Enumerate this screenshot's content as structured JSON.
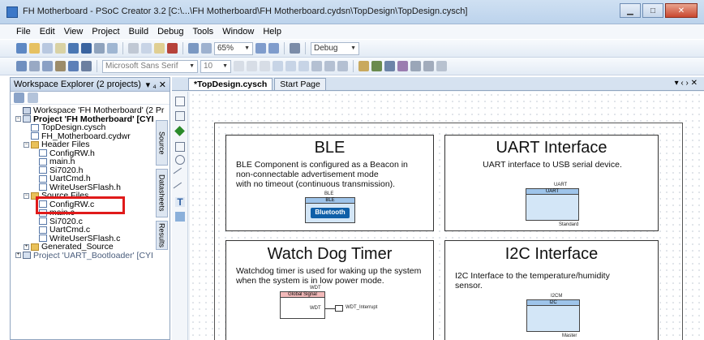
{
  "window": {
    "title": "FH Motherboard - PSoC Creator 3.2  [C:\\...\\FH Motherboard\\FH Motherboard.cydsn\\TopDesign\\TopDesign.cysch]"
  },
  "menu": [
    "File",
    "Edit",
    "View",
    "Project",
    "Build",
    "Debug",
    "Tools",
    "Window",
    "Help"
  ],
  "toolbar": {
    "zoom": "65%",
    "config": "Debug",
    "font_name": "Microsoft Sans Serif",
    "font_size": "10"
  },
  "workspace": {
    "title": "Workspace Explorer (2 projects)",
    "pin": "▾ ₄ ✕",
    "tree": [
      {
        "label": "Workspace 'FH Motherboard' (2 Pr",
        "indent": 0,
        "icon": "ws",
        "style": ""
      },
      {
        "label": "Project 'FH Motherboard' [CYI",
        "indent": 0,
        "icon": "proj",
        "style": "bold",
        "exp": "−"
      },
      {
        "label": "TopDesign.cysch",
        "indent": 1,
        "icon": "file",
        "style": ""
      },
      {
        "label": "FH_Motherboard.cydwr",
        "indent": 1,
        "icon": "file",
        "style": ""
      },
      {
        "label": "Header Files",
        "indent": 1,
        "icon": "folder",
        "style": "",
        "exp": "−"
      },
      {
        "label": "ConfigRW.h",
        "indent": 2,
        "icon": "file",
        "style": ""
      },
      {
        "label": "main.h",
        "indent": 2,
        "icon": "file",
        "style": ""
      },
      {
        "label": "Si7020.h",
        "indent": 2,
        "icon": "file",
        "style": ""
      },
      {
        "label": "UartCmd.h",
        "indent": 2,
        "icon": "file",
        "style": ""
      },
      {
        "label": "WriteUserSFlash.h",
        "indent": 2,
        "icon": "file",
        "style": ""
      },
      {
        "label": "Source Files",
        "indent": 1,
        "icon": "folder",
        "style": "",
        "exp": "−"
      },
      {
        "label": "ConfigRW.c",
        "indent": 2,
        "icon": "file",
        "style": ""
      },
      {
        "label": "main.c",
        "indent": 2,
        "icon": "file",
        "style": ""
      },
      {
        "label": "Si7020.c",
        "indent": 2,
        "icon": "file",
        "style": ""
      },
      {
        "label": "UartCmd.c",
        "indent": 2,
        "icon": "file",
        "style": ""
      },
      {
        "label": "WriteUserSFlash.c",
        "indent": 2,
        "icon": "file",
        "style": ""
      },
      {
        "label": "Generated_Source",
        "indent": 1,
        "icon": "folder",
        "style": "",
        "exp": "+"
      },
      {
        "label": "Project 'UART_Bootloader' [CYI",
        "indent": 0,
        "icon": "proj",
        "style": "dim",
        "exp": "+"
      }
    ],
    "side_tabs": [
      "Source",
      "Datasheets",
      "Results"
    ]
  },
  "editor": {
    "tabs": [
      "*TopDesign.cysch",
      "Start Page"
    ],
    "tab_controls": "▾ ‹ › ✕"
  },
  "schematic": {
    "ble": {
      "title": "BLE",
      "desc": [
        "BLE Component is configured as a Beacon in",
        "non-connectable advertisement mode",
        "with no timeout (continuous transmission)."
      ],
      "comp_name": "BLE",
      "comp_head": "BLE",
      "logo": "Bluetooth"
    },
    "uart": {
      "title": "UART Interface",
      "desc": [
        "UART interface to USB serial device."
      ],
      "comp_name": "UART",
      "comp_head": "UART",
      "comp_mode": "Standard"
    },
    "wdt": {
      "title": "Watch Dog Timer",
      "desc": [
        "Watchdog timer is used for waking up the system",
        "when the system is in low power mode."
      ],
      "comp_name": "WDT",
      "comp_head": "Global Signal",
      "pin": "WDT",
      "net": "WDT_Interrupt"
    },
    "i2c": {
      "title": "I2C Interface",
      "desc": [
        "I2C Interface to the temperature/humidity",
        "sensor."
      ],
      "comp_name": "I2CM",
      "comp_head": "I2C",
      "comp_mode": "Master"
    }
  },
  "colors": {
    "highlight": "#e01a1a",
    "component_fill": "#d3e6f7",
    "component_head": "#9ec4ea"
  }
}
